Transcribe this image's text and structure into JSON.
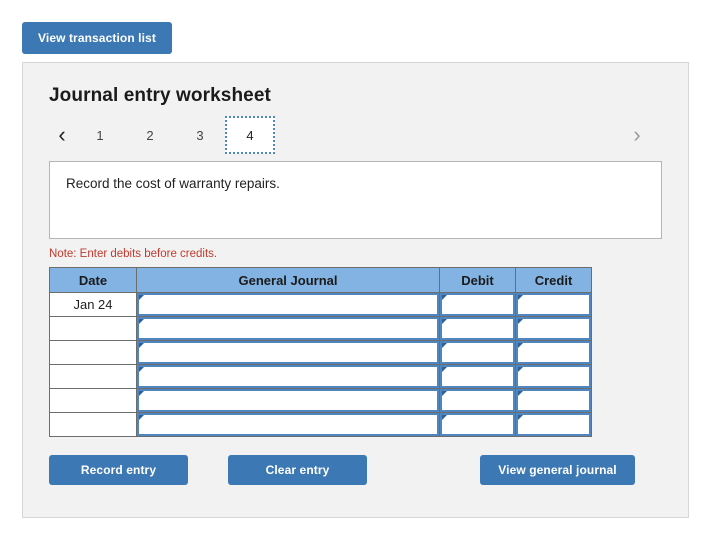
{
  "top": {
    "view_transaction_list_label": "View transaction list"
  },
  "panel": {
    "title": "Journal entry worksheet",
    "tabs": [
      {
        "label": "1",
        "active": false
      },
      {
        "label": "2",
        "active": false
      },
      {
        "label": "3",
        "active": false
      },
      {
        "label": "4",
        "active": true
      }
    ],
    "nav": {
      "prev_icon": "chevron-left-icon",
      "next_icon": "chevron-right-icon",
      "prev_glyph": "‹",
      "next_glyph": "›"
    },
    "description": "Record the cost of warranty repairs.",
    "note": "Note: Enter debits before credits.",
    "table": {
      "headers": [
        "Date",
        "General Journal",
        "Debit",
        "Credit"
      ],
      "rows": [
        {
          "date": "Jan 24",
          "general_journal": "",
          "debit": "",
          "credit": ""
        },
        {
          "date": "",
          "general_journal": "",
          "debit": "",
          "credit": ""
        },
        {
          "date": "",
          "general_journal": "",
          "debit": "",
          "credit": ""
        },
        {
          "date": "",
          "general_journal": "",
          "debit": "",
          "credit": ""
        },
        {
          "date": "",
          "general_journal": "",
          "debit": "",
          "credit": ""
        },
        {
          "date": "",
          "general_journal": "",
          "debit": "",
          "credit": ""
        }
      ]
    },
    "buttons": {
      "record_entry": "Record entry",
      "clear_entry": "Clear entry",
      "view_general_journal": "View general journal"
    }
  },
  "colors": {
    "button_blue": "#3c78b4",
    "table_header_blue": "#82b3e2",
    "input_border_blue": "#4f86c0",
    "note_red": "#c23b2e",
    "panel_bg": "#f2f2f2",
    "panel_border": "#d6d6d6"
  }
}
